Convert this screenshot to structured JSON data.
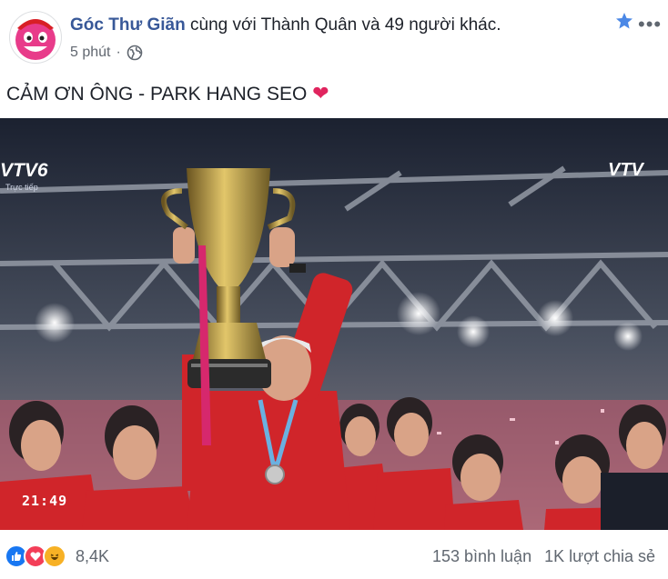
{
  "post": {
    "page_name": "Góc Thư Giãn",
    "with_text": "cùng với Thành Quân và 49 người khác.",
    "time": "5 phút",
    "caption": "CẢM ƠN ÔNG - PARK HANG SEO",
    "caption_emoji": "❤"
  },
  "photo": {
    "broadcaster_left": "VTV6",
    "broadcaster_left_sub": "Trực tiếp",
    "broadcaster_right": "VTV",
    "clock": "21:49"
  },
  "footer": {
    "reaction_count": "8,4K",
    "comments": "153 bình luận",
    "shares": "1K lượt chia sẻ"
  },
  "colors": {
    "link": "#385898",
    "jersey": "#d0252a",
    "like_blue": "#1877f2"
  }
}
